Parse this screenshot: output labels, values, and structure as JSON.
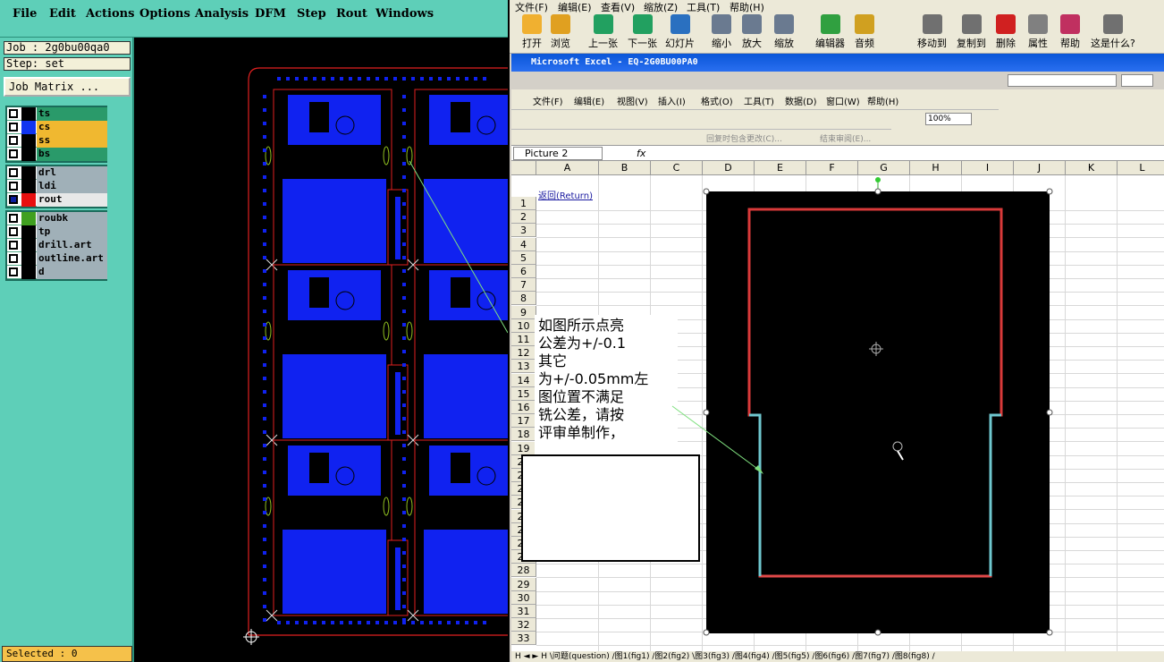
{
  "cam": {
    "menu": [
      "File",
      "Edit",
      "Actions",
      "Options",
      "Analysis",
      "DFM",
      "Step",
      "Rout",
      "Windows"
    ],
    "job_label": "Job : 2g0bu00qa0",
    "step_label": "Step: set",
    "job_matrix_button": "Job Matrix ...",
    "layer_groups": [
      [
        {
          "name": "ts",
          "color": "#2a9a6a"
        },
        {
          "name": "cs",
          "color": "#f0b830"
        },
        {
          "name": "ss",
          "color": "#f0b830"
        },
        {
          "name": "bs",
          "color": "#2a9a6a"
        }
      ],
      [
        {
          "name": "drl",
          "color": "#a0b0b8"
        },
        {
          "name": "ldi",
          "color": "#a0b0b8"
        },
        {
          "name": "rout",
          "color": "#e8e8e8",
          "swatch": "#e81010",
          "active": true
        }
      ],
      [
        {
          "name": "roubk",
          "color": "#a0b0b8",
          "swatch": "#40a020"
        },
        {
          "name": "tp",
          "color": "#a0b0b8"
        },
        {
          "name": "drill.art",
          "color": "#a0b0b8"
        },
        {
          "name": "outline.art",
          "color": "#a0b0b8"
        },
        {
          "name": "d",
          "color": "#a0b0b8"
        }
      ]
    ],
    "status": "Selected : 0"
  },
  "excel": {
    "menu": [
      "文件(F)",
      "编辑(E)",
      "查看(V)",
      "缩放(Z)",
      "工具(T)",
      "帮助(H)"
    ],
    "toolbar": [
      "打开",
      "浏览",
      "上一张",
      "下一张",
      "幻灯片",
      "缩小",
      "放大",
      "缩放",
      "编辑器",
      "音频",
      "移动到",
      "复制到",
      "删除",
      "属性",
      "帮助",
      "这是什么?"
    ],
    "title": "Microsoft Excel - EQ-2G0BU00PA0",
    "menu2": [
      "文件(F)",
      "编辑(E)",
      "视图(V)",
      "插入(I)",
      "格式(O)",
      "工具(T)",
      "数据(D)",
      "窗口(W)",
      "帮助(H)"
    ],
    "zoom": "100%",
    "review_text": "回复时包含更改(C)...",
    "end_review": "结束审阅(E)...",
    "name_box": "Picture 2",
    "fx": "fx",
    "columns": [
      "A",
      "B",
      "C",
      "D",
      "E",
      "F",
      "G",
      "H",
      "I",
      "J",
      "K",
      "L"
    ],
    "rows": [
      "1",
      "2",
      "3",
      "4",
      "5",
      "6",
      "7",
      "8",
      "9",
      "10",
      "11",
      "12",
      "13",
      "14",
      "15",
      "16",
      "17",
      "18",
      "19",
      "20",
      "21",
      "22",
      "23",
      "24",
      "25",
      "26",
      "27",
      "28",
      "29",
      "30",
      "31",
      "32",
      "33"
    ],
    "return_link": "返回(Return)",
    "callout": "如图所示点亮\n公差为+/-0.1\n其它\n为+/-0.05mm左\n图位置不满足\n铣公差，请按\n评审单制作，",
    "sheet_tabs": "H ◄ ► H \\问题(question) /图1(fig1) /图2(fig2) \\图3(fig3) /图4(fig4) /图5(fig5) /图6(fig6) /图7(fig7) /图8(fig8) /"
  }
}
